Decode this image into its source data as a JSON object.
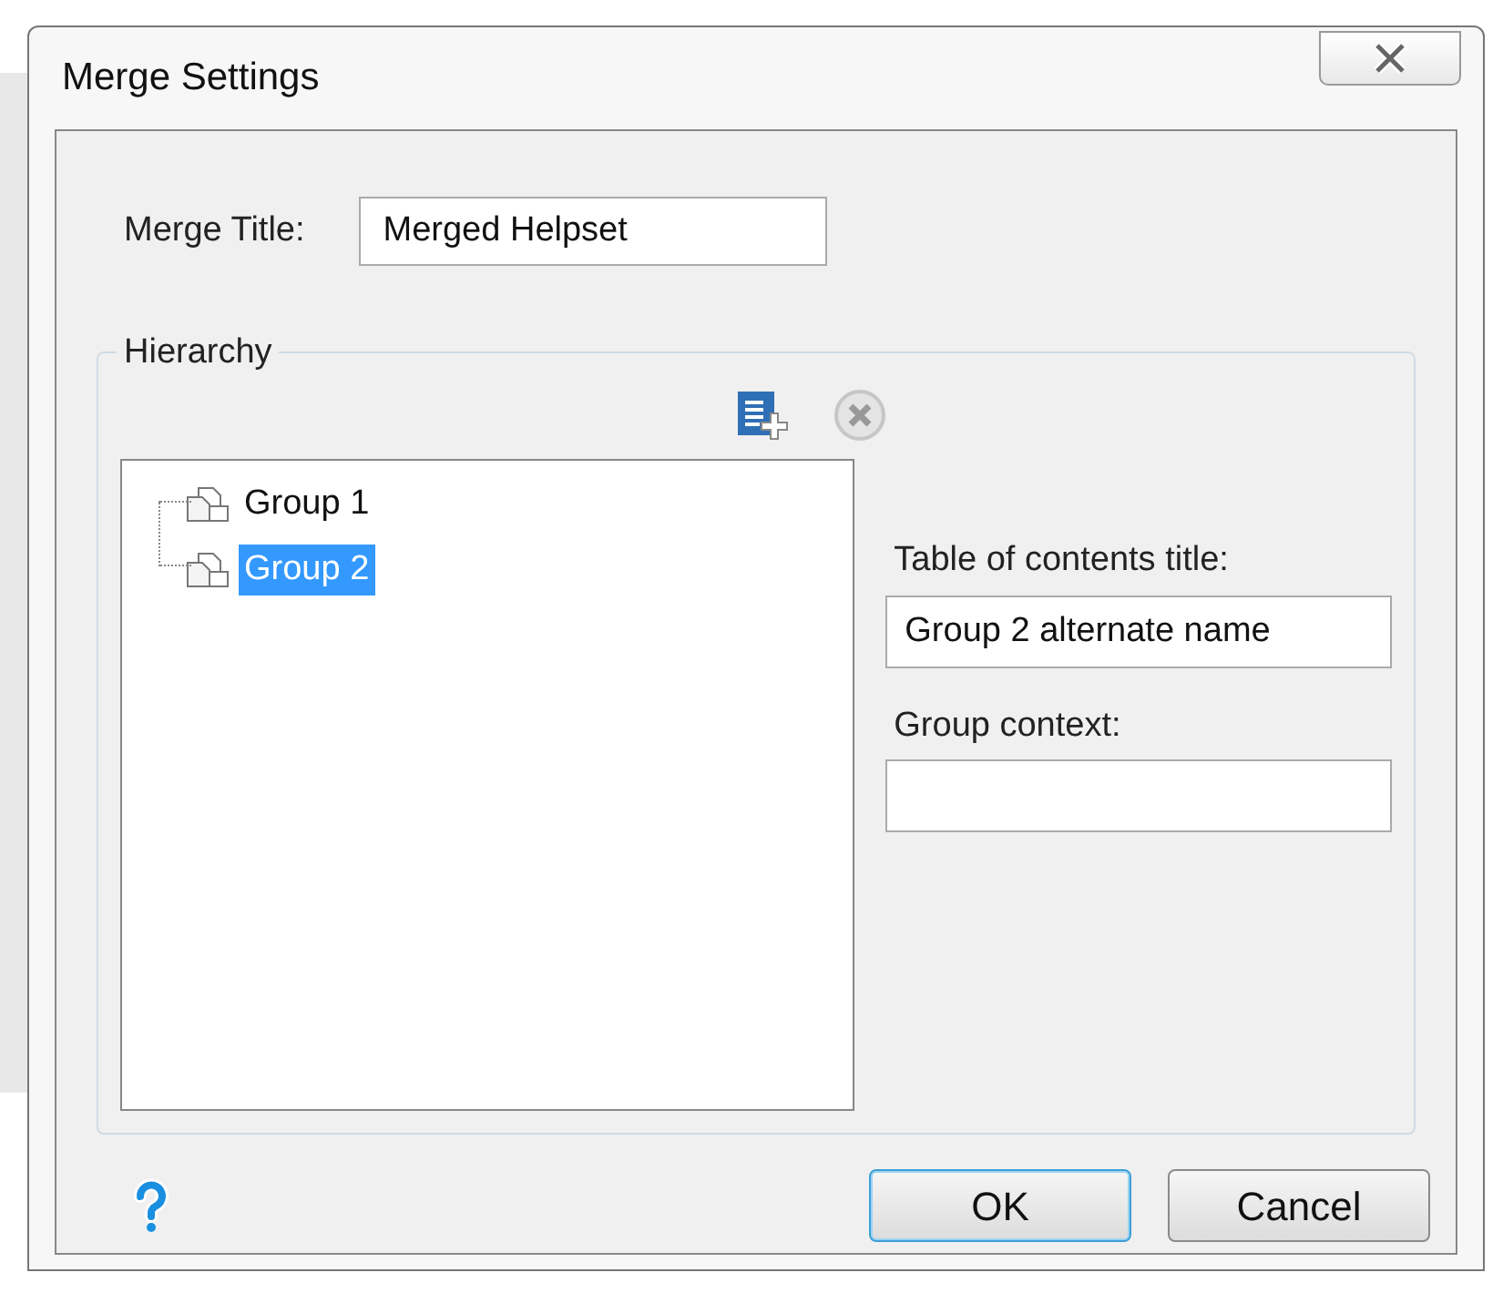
{
  "window": {
    "title": "Merge Settings"
  },
  "merge_title": {
    "label": "Merge Title:",
    "value": "Merged Helpset"
  },
  "hierarchy": {
    "legend": "Hierarchy",
    "tree": [
      {
        "label": "Group 1",
        "selected": false
      },
      {
        "label": "Group 2",
        "selected": true
      }
    ],
    "toc_title": {
      "label": "Table of contents title:",
      "value": "Group 2 alternate name"
    },
    "group_context": {
      "label": "Group context:"
    }
  },
  "buttons": [
    {
      "label": "OK",
      "kind": "default"
    },
    {
      "label": "Cancel",
      "kind": "normal"
    }
  ]
}
